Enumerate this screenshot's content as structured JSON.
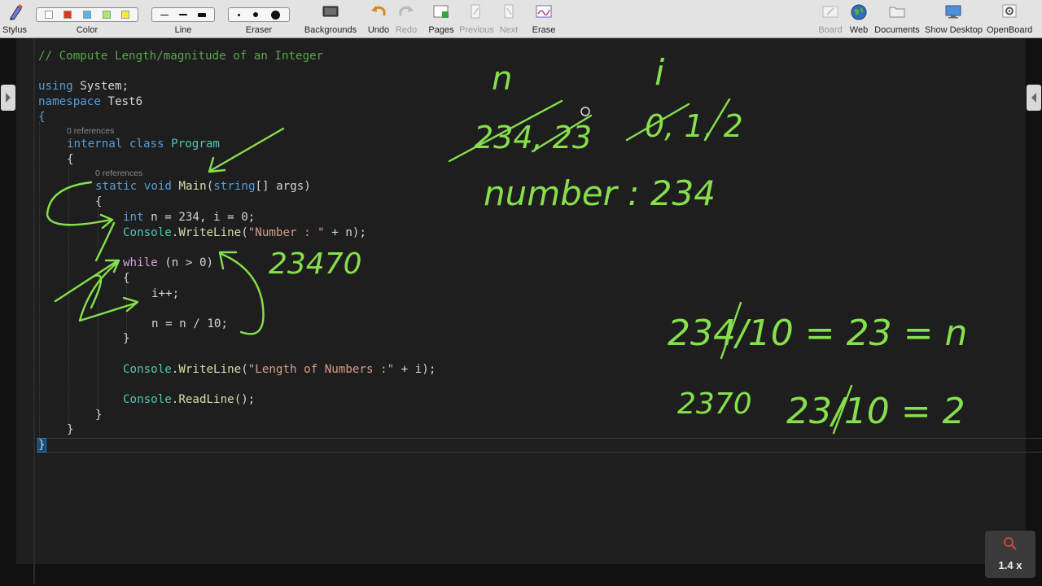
{
  "toolbar": {
    "stylus": "Stylus",
    "color": "Color",
    "line": "Line",
    "eraser": "Eraser",
    "backgrounds": "Backgrounds",
    "undo": "Undo",
    "redo": "Redo",
    "pages": "Pages",
    "previous": "Previous",
    "next": "Next",
    "erase": "Erase",
    "board": "Board",
    "web": "Web",
    "documents": "Documents",
    "show_desktop": "Show Desktop",
    "openboard": "OpenBoard",
    "colors": [
      "#ffffff",
      "#e8321e",
      "#54b6ec",
      "#a5e86c",
      "#f3ee2a"
    ]
  },
  "code": {
    "comment": "// Compute Length/magnitude of an Integer",
    "using_kw": "using",
    "using_rest": " System;",
    "namespace_kw": "namespace",
    "namespace_rest": " Test6",
    "open_brace": "{",
    "refs1": "0 references",
    "internal_kw": "internal",
    "class_kw": "class",
    "class_name": "Program",
    "refs2": "0 references",
    "static_kw": "static",
    "void_kw": "void",
    "main_name": "Main",
    "string_kw": "string",
    "args_rest": "[] args)",
    "int_kw": "int",
    "decl_rest": " n = 234, i = 0;",
    "console": "Console",
    "writeline": "WriteLine",
    "str_number": "\"Number : \"",
    "wl1_rest": " + n);",
    "while_kw": "while",
    "while_rest": " (n > 0)",
    "inc": "i++;",
    "div": "n = n / 10;",
    "str_length": "\"Length of Numbers :\"",
    "wl2_rest": " + i);",
    "readline": "ReadLine",
    "readline_rest": "();",
    "close_brace": "}"
  },
  "annotations": {
    "n_label": "n",
    "i_label": "i",
    "n_values": "234, 23",
    "i_values": "0, 1, 2",
    "number_line": "number : 234",
    "trace1": "23470",
    "eq1": "234/10 = 23 = n",
    "trace2": "2370",
    "eq2": "23/10 = 2"
  },
  "zoom": "1.4 x"
}
